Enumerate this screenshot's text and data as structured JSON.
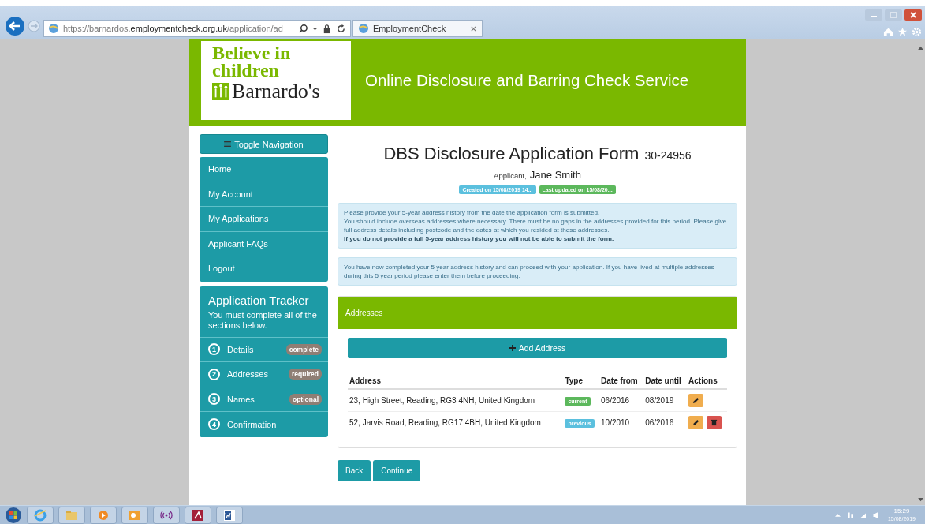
{
  "browser": {
    "url_host": "https://barnardos.",
    "url_domain": "employmentcheck.org.uk",
    "url_path": "/application/ad",
    "tab_title": "EmploymentCheck"
  },
  "header": {
    "logo_lines": [
      "Believe in",
      "children",
      "Barnardo's"
    ],
    "title": "Online Disclosure and Barring Check Service"
  },
  "navigation": {
    "toggle": "Toggle Navigation",
    "items": [
      "Home",
      "My Account",
      "My Applications",
      "Applicant FAQs",
      "Logout"
    ]
  },
  "tracker": {
    "title": "Application Tracker",
    "subtitle": "You must complete all of the sections below.",
    "steps": [
      {
        "number": "1",
        "label": "Details",
        "status": "complete"
      },
      {
        "number": "2",
        "label": "Addresses",
        "status": "required"
      },
      {
        "number": "3",
        "label": "Names",
        "status": "optional"
      },
      {
        "number": "4",
        "label": "Confirmation"
      }
    ]
  },
  "form": {
    "title": "DBS Disclosure Application Form",
    "reference": "30-24956",
    "applicant_label": "Applicant,",
    "applicant_name": "Jane Smith",
    "badges": [
      {
        "text": "Created on 15/08/2019 14...",
        "color": "#5bc0de"
      },
      {
        "text": "Last updated on 15/08/20...",
        "color": "#5cb85c"
      }
    ]
  },
  "notices": [
    {
      "paragraphs": [
        {
          "text": "Please provide your 5-year address history from the date the application form is submitted.",
          "bold": false
        },
        {
          "text": "You should include overseas addresses where necessary. There must be no gaps in the addresses provided for this period. Please give full address details including postcode and the dates at which you resided at these addresses.",
          "bold": false
        },
        {
          "text": "If you do not provide a full 5-year address history you will not be able to submit the form.",
          "bold": true
        }
      ]
    },
    {
      "paragraphs": [
        {
          "text": "You have now completed your 5 year address history and can proceed with your application. If you have lived at multiple addresses during this 5 year period please enter them before proceeding.",
          "bold": false
        }
      ]
    }
  ],
  "addresses": {
    "title": "Addresses",
    "add_button": "Add Address",
    "columns": [
      "Address",
      "Type",
      "Date from",
      "Date until",
      "Actions"
    ],
    "rows": [
      {
        "address": "23, High Street, Reading, RG3 4NH, United Kingdom",
        "type": "current",
        "color": "#5cb85c",
        "date_from": "06/2016",
        "date_until": "08/2019",
        "deletable": false
      },
      {
        "address": "52, Jarvis Road, Reading, RG17 4BH, United Kingdom",
        "type": "previous",
        "color": "#5bc0de",
        "date_from": "10/2010",
        "date_until": "06/2016",
        "deletable": true
      }
    ]
  },
  "buttons": [
    "Back",
    "Continue"
  ],
  "taskbar": {
    "time": "15:29",
    "date": "15/08/2019"
  }
}
